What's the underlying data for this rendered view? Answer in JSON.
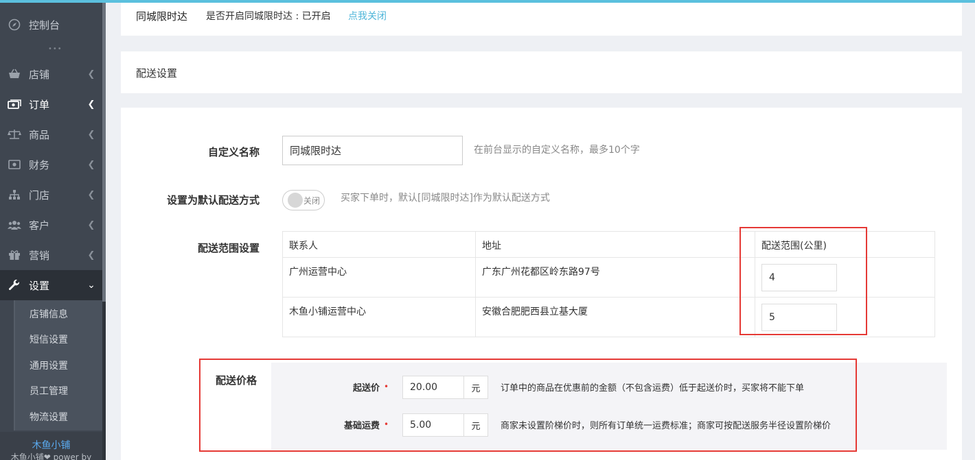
{
  "sidebar": {
    "items": [
      {
        "label": "控制台",
        "icon": "compass-icon"
      },
      {
        "label": "店铺",
        "icon": "basket-icon"
      },
      {
        "label": "订单",
        "icon": "money-icon"
      },
      {
        "label": "商品",
        "icon": "scale-icon"
      },
      {
        "label": "财务",
        "icon": "cash-icon"
      },
      {
        "label": "门店",
        "icon": "sitemap-icon"
      },
      {
        "label": "客户",
        "icon": "users-icon"
      },
      {
        "label": "营销",
        "icon": "gift-icon"
      },
      {
        "label": "设置",
        "icon": "wrench-icon"
      }
    ],
    "more": "•••",
    "sub_items": [
      {
        "label": "店铺信息"
      },
      {
        "label": "短信设置"
      },
      {
        "label": "通用设置"
      },
      {
        "label": "员工管理"
      },
      {
        "label": "物流设置"
      }
    ],
    "footer": {
      "brand": "木鱼小铺",
      "power": "木鱼小铺❤ power by"
    }
  },
  "status_bar": {
    "title": "同城限时达",
    "status_text": "是否开启同城限时达 : 已开启",
    "action_link": "点我关闭"
  },
  "section": {
    "title": "配送设置"
  },
  "form": {
    "custom_name": {
      "label": "自定义名称",
      "value": "同城限时达",
      "help": "在前台显示的自定义名称，最多10个字"
    },
    "default_method": {
      "label": "设置为默认配送方式",
      "toggle_text": "关闭",
      "help": "买家下单时，默认[同城限时达]作为默认配送方式"
    },
    "range": {
      "label": "配送范围设置",
      "headers": [
        "联系人",
        "地址",
        "配送范围(公里)"
      ],
      "rows": [
        {
          "contact": "广州运营中心",
          "address": "广东广州花都区岭东路97号",
          "range": "4"
        },
        {
          "contact": "木鱼小铺运营中心",
          "address": "安徽合肥肥西县立基大厦",
          "range": "5"
        }
      ]
    },
    "price": {
      "title": "配送价格",
      "required_mark": "•",
      "min_order": {
        "label": "起送价",
        "value": "20.00",
        "unit": "元",
        "help": "订单中的商品在优惠前的金额（不包含运费）低于起送价时，买家将不能下单"
      },
      "base_fee": {
        "label": "基础运费",
        "value": "5.00",
        "unit": "元",
        "help": "商家未设置阶梯价时，则所有订单统一运费标准；商家可按配送服务半径设置阶梯价"
      }
    }
  },
  "colors": {
    "accent": "#4fb6d9",
    "highlight_border": "#e53935",
    "sidebar_bg": "#3f4650"
  }
}
